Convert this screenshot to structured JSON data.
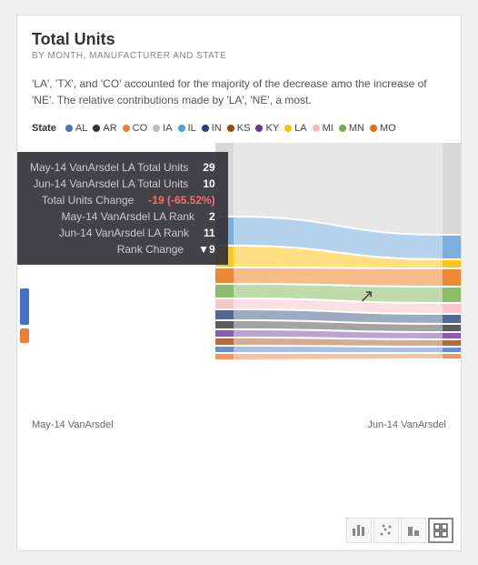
{
  "card": {
    "title": "Total Units",
    "subtitle": "BY MONTH, MANUFACTURER AND STATE",
    "description": "'LA', 'TX', and 'CO' accounted for the majority of the decrease amo the increase of 'NE'. The relative contributions made by 'LA', 'NE', a most."
  },
  "legend": {
    "label": "State",
    "items": [
      {
        "name": "AL",
        "color": "#4472C4"
      },
      {
        "name": "AR",
        "color": "#333333"
      },
      {
        "name": "CO",
        "color": "#ED7D31"
      },
      {
        "name": "IA",
        "color": "#c0c0c0"
      },
      {
        "name": "IL",
        "color": "#5B9BD5"
      },
      {
        "name": "IN",
        "color": "#264478"
      },
      {
        "name": "KS",
        "color": "#9E480E"
      },
      {
        "name": "KY",
        "color": "#7030A0"
      },
      {
        "name": "LA",
        "color": "#FFC000"
      },
      {
        "name": "MI",
        "color": "#f4b8c1"
      },
      {
        "name": "MN",
        "color": "#70AD47"
      },
      {
        "name": "MO",
        "color": "#EA6B00"
      }
    ]
  },
  "tooltip": {
    "rows": [
      {
        "key": "May-14 VanArsdel LA Total Units",
        "value": "29"
      },
      {
        "key": "Jun-14 VanArsdel LA Total Units",
        "value": "10"
      },
      {
        "key": "Total Units Change",
        "value": "-19 (-65.52%)"
      },
      {
        "key": "May-14 VanArsdel LA Rank",
        "value": "2"
      },
      {
        "key": "Jun-14 VanArsdel LA Rank",
        "value": "11"
      },
      {
        "key": "Rank Change",
        "value": "▼9"
      }
    ]
  },
  "axis": {
    "left_label": "May-14 VanArsdel",
    "right_label": "Jun-14 VanArsdel"
  },
  "toolbar": {
    "buttons": [
      {
        "icon": "📊",
        "label": "bar-chart",
        "active": false
      },
      {
        "icon": "⋯",
        "label": "scatter",
        "active": false
      },
      {
        "icon": "▐▌",
        "label": "column",
        "active": false
      },
      {
        "icon": "⊞",
        "label": "matrix",
        "active": true
      }
    ]
  }
}
